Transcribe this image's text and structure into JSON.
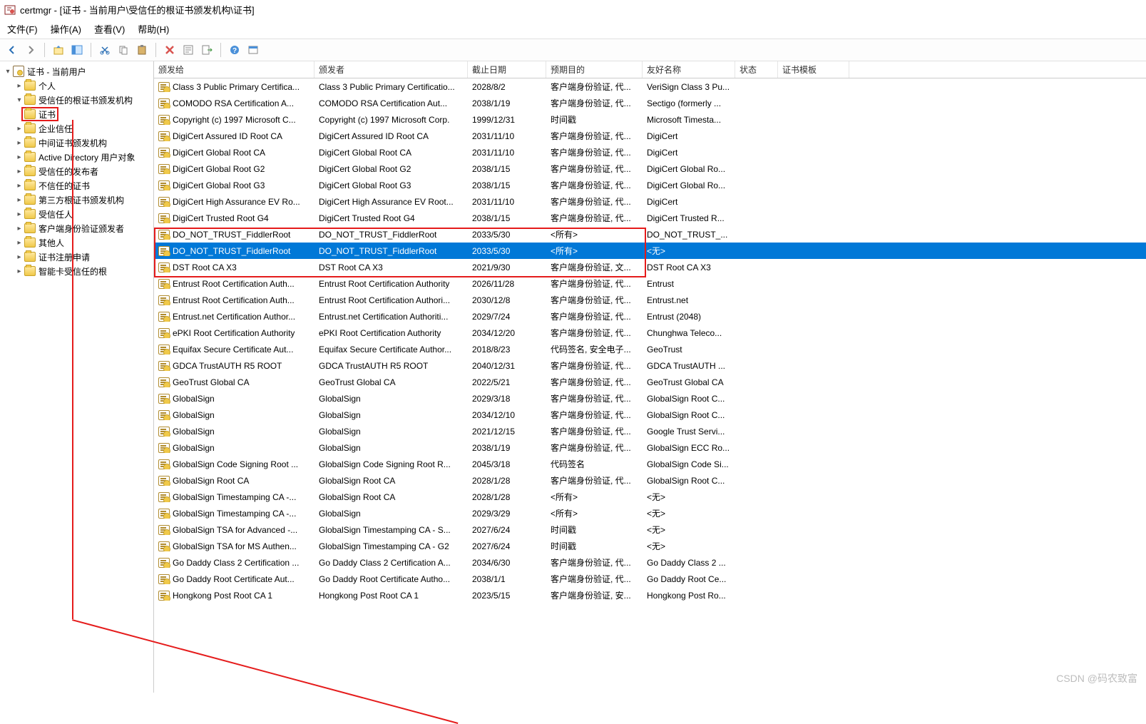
{
  "window": {
    "title": "certmgr - [证书 - 当前用户\\受信任的根证书颁发机构\\证书]"
  },
  "menu": {
    "file": "文件(F)",
    "action": "操作(A)",
    "view": "查看(V)",
    "help": "帮助(H)"
  },
  "watermark": "CSDN @码农致富",
  "columns": [
    "颁发给",
    "颁发者",
    "截止日期",
    "预期目的",
    "友好名称",
    "状态",
    "证书模板"
  ],
  "tree": [
    {
      "depth": 0,
      "tw": "▾",
      "icon": "cert",
      "label": "证书 - 当前用户"
    },
    {
      "depth": 1,
      "tw": "▸",
      "icon": "folder",
      "label": "个人"
    },
    {
      "depth": 1,
      "tw": "▾",
      "icon": "folder",
      "label": "受信任的根证书颁发机构"
    },
    {
      "depth": 2,
      "tw": "",
      "icon": "folder",
      "label": "证书",
      "selected": true
    },
    {
      "depth": 1,
      "tw": "▸",
      "icon": "folder",
      "label": "企业信任"
    },
    {
      "depth": 1,
      "tw": "▸",
      "icon": "folder",
      "label": "中间证书颁发机构"
    },
    {
      "depth": 1,
      "tw": "▸",
      "icon": "folder",
      "label": "Active Directory 用户对象"
    },
    {
      "depth": 1,
      "tw": "▸",
      "icon": "folder",
      "label": "受信任的发布者"
    },
    {
      "depth": 1,
      "tw": "▸",
      "icon": "folder",
      "label": "不信任的证书"
    },
    {
      "depth": 1,
      "tw": "▸",
      "icon": "folder",
      "label": "第三方根证书颁发机构"
    },
    {
      "depth": 1,
      "tw": "▸",
      "icon": "folder",
      "label": "受信任人"
    },
    {
      "depth": 1,
      "tw": "▸",
      "icon": "folder",
      "label": "客户端身份验证颁发者"
    },
    {
      "depth": 1,
      "tw": "▸",
      "icon": "folder",
      "label": "其他人"
    },
    {
      "depth": 1,
      "tw": "▸",
      "icon": "folder",
      "label": "证书注册申请"
    },
    {
      "depth": 1,
      "tw": "▸",
      "icon": "folder",
      "label": "智能卡受信任的根"
    }
  ],
  "rows": [
    [
      "Class 3 Public Primary Certifica...",
      "Class 3 Public Primary Certificatio...",
      "2028/8/2",
      "客户端身份验证, 代...",
      "VeriSign Class 3 Pu...",
      "",
      ""
    ],
    [
      "COMODO RSA Certification A...",
      "COMODO RSA Certification Aut...",
      "2038/1/19",
      "客户端身份验证, 代...",
      "Sectigo (formerly ...",
      "",
      ""
    ],
    [
      "Copyright (c) 1997 Microsoft C...",
      "Copyright (c) 1997 Microsoft Corp.",
      "1999/12/31",
      "时间戳",
      "Microsoft Timesta...",
      "",
      ""
    ],
    [
      "DigiCert Assured ID Root CA",
      "DigiCert Assured ID Root CA",
      "2031/11/10",
      "客户端身份验证, 代...",
      "DigiCert",
      "",
      ""
    ],
    [
      "DigiCert Global Root CA",
      "DigiCert Global Root CA",
      "2031/11/10",
      "客户端身份验证, 代...",
      "DigiCert",
      "",
      ""
    ],
    [
      "DigiCert Global Root G2",
      "DigiCert Global Root G2",
      "2038/1/15",
      "客户端身份验证, 代...",
      "DigiCert Global Ro...",
      "",
      ""
    ],
    [
      "DigiCert Global Root G3",
      "DigiCert Global Root G3",
      "2038/1/15",
      "客户端身份验证, 代...",
      "DigiCert Global Ro...",
      "",
      ""
    ],
    [
      "DigiCert High Assurance EV Ro...",
      "DigiCert High Assurance EV Root...",
      "2031/11/10",
      "客户端身份验证, 代...",
      "DigiCert",
      "",
      ""
    ],
    [
      "DigiCert Trusted Root G4",
      "DigiCert Trusted Root G4",
      "2038/1/15",
      "客户端身份验证, 代...",
      "DigiCert Trusted R...",
      "",
      ""
    ],
    [
      "DO_NOT_TRUST_FiddlerRoot",
      "DO_NOT_TRUST_FiddlerRoot",
      "2033/5/30",
      "<所有>",
      "DO_NOT_TRUST_...",
      "",
      ""
    ],
    [
      "DO_NOT_TRUST_FiddlerRoot",
      "DO_NOT_TRUST_FiddlerRoot",
      "2033/5/30",
      "<所有>",
      "<无>",
      "",
      "",
      true
    ],
    [
      "DST Root CA X3",
      "DST Root CA X3",
      "2021/9/30",
      "客户端身份验证, 文...",
      "DST Root CA X3",
      "",
      ""
    ],
    [
      "Entrust Root Certification Auth...",
      "Entrust Root Certification Authority",
      "2026/11/28",
      "客户端身份验证, 代...",
      "Entrust",
      "",
      ""
    ],
    [
      "Entrust Root Certification Auth...",
      "Entrust Root Certification Authori...",
      "2030/12/8",
      "客户端身份验证, 代...",
      "Entrust.net",
      "",
      ""
    ],
    [
      "Entrust.net Certification Author...",
      "Entrust.net Certification Authoriti...",
      "2029/7/24",
      "客户端身份验证, 代...",
      "Entrust (2048)",
      "",
      ""
    ],
    [
      "ePKI Root Certification Authority",
      "ePKI Root Certification Authority",
      "2034/12/20",
      "客户端身份验证, 代...",
      "Chunghwa Teleco...",
      "",
      ""
    ],
    [
      "Equifax Secure Certificate Aut...",
      "Equifax Secure Certificate Author...",
      "2018/8/23",
      "代码签名, 安全电子...",
      "GeoTrust",
      "",
      ""
    ],
    [
      "GDCA TrustAUTH R5 ROOT",
      "GDCA TrustAUTH R5 ROOT",
      "2040/12/31",
      "客户端身份验证, 代...",
      "GDCA TrustAUTH ...",
      "",
      ""
    ],
    [
      "GeoTrust Global CA",
      "GeoTrust Global CA",
      "2022/5/21",
      "客户端身份验证, 代...",
      "GeoTrust Global CA",
      "",
      ""
    ],
    [
      "GlobalSign",
      "GlobalSign",
      "2029/3/18",
      "客户端身份验证, 代...",
      "GlobalSign Root C...",
      "",
      ""
    ],
    [
      "GlobalSign",
      "GlobalSign",
      "2034/12/10",
      "客户端身份验证, 代...",
      "GlobalSign Root C...",
      "",
      ""
    ],
    [
      "GlobalSign",
      "GlobalSign",
      "2021/12/15",
      "客户端身份验证, 代...",
      "Google Trust Servi...",
      "",
      ""
    ],
    [
      "GlobalSign",
      "GlobalSign",
      "2038/1/19",
      "客户端身份验证, 代...",
      "GlobalSign ECC Ro...",
      "",
      ""
    ],
    [
      "GlobalSign Code Signing Root ...",
      "GlobalSign Code Signing Root R...",
      "2045/3/18",
      "代码签名",
      "GlobalSign Code Si...",
      "",
      ""
    ],
    [
      "GlobalSign Root CA",
      "GlobalSign Root CA",
      "2028/1/28",
      "客户端身份验证, 代...",
      "GlobalSign Root C...",
      "",
      ""
    ],
    [
      "GlobalSign Timestamping CA -...",
      "GlobalSign Root CA",
      "2028/1/28",
      "<所有>",
      "<无>",
      "",
      ""
    ],
    [
      "GlobalSign Timestamping CA -...",
      "GlobalSign",
      "2029/3/29",
      "<所有>",
      "<无>",
      "",
      ""
    ],
    [
      "GlobalSign TSA for Advanced -...",
      "GlobalSign Timestamping CA - S...",
      "2027/6/24",
      "时间戳",
      "<无>",
      "",
      ""
    ],
    [
      "GlobalSign TSA for MS Authen...",
      "GlobalSign Timestamping CA - G2",
      "2027/6/24",
      "时间戳",
      "<无>",
      "",
      ""
    ],
    [
      "Go Daddy Class 2 Certification ...",
      "Go Daddy Class 2 Certification A...",
      "2034/6/30",
      "客户端身份验证, 代...",
      "Go Daddy Class 2 ...",
      "",
      ""
    ],
    [
      "Go Daddy Root Certificate Aut...",
      "Go Daddy Root Certificate Autho...",
      "2038/1/1",
      "客户端身份验证, 代...",
      "Go Daddy Root Ce...",
      "",
      ""
    ],
    [
      "Hongkong Post Root CA 1",
      "Hongkong Post Root CA 1",
      "2023/5/15",
      "客户端身份验证, 安...",
      "Hongkong Post Ro...",
      "",
      ""
    ]
  ]
}
